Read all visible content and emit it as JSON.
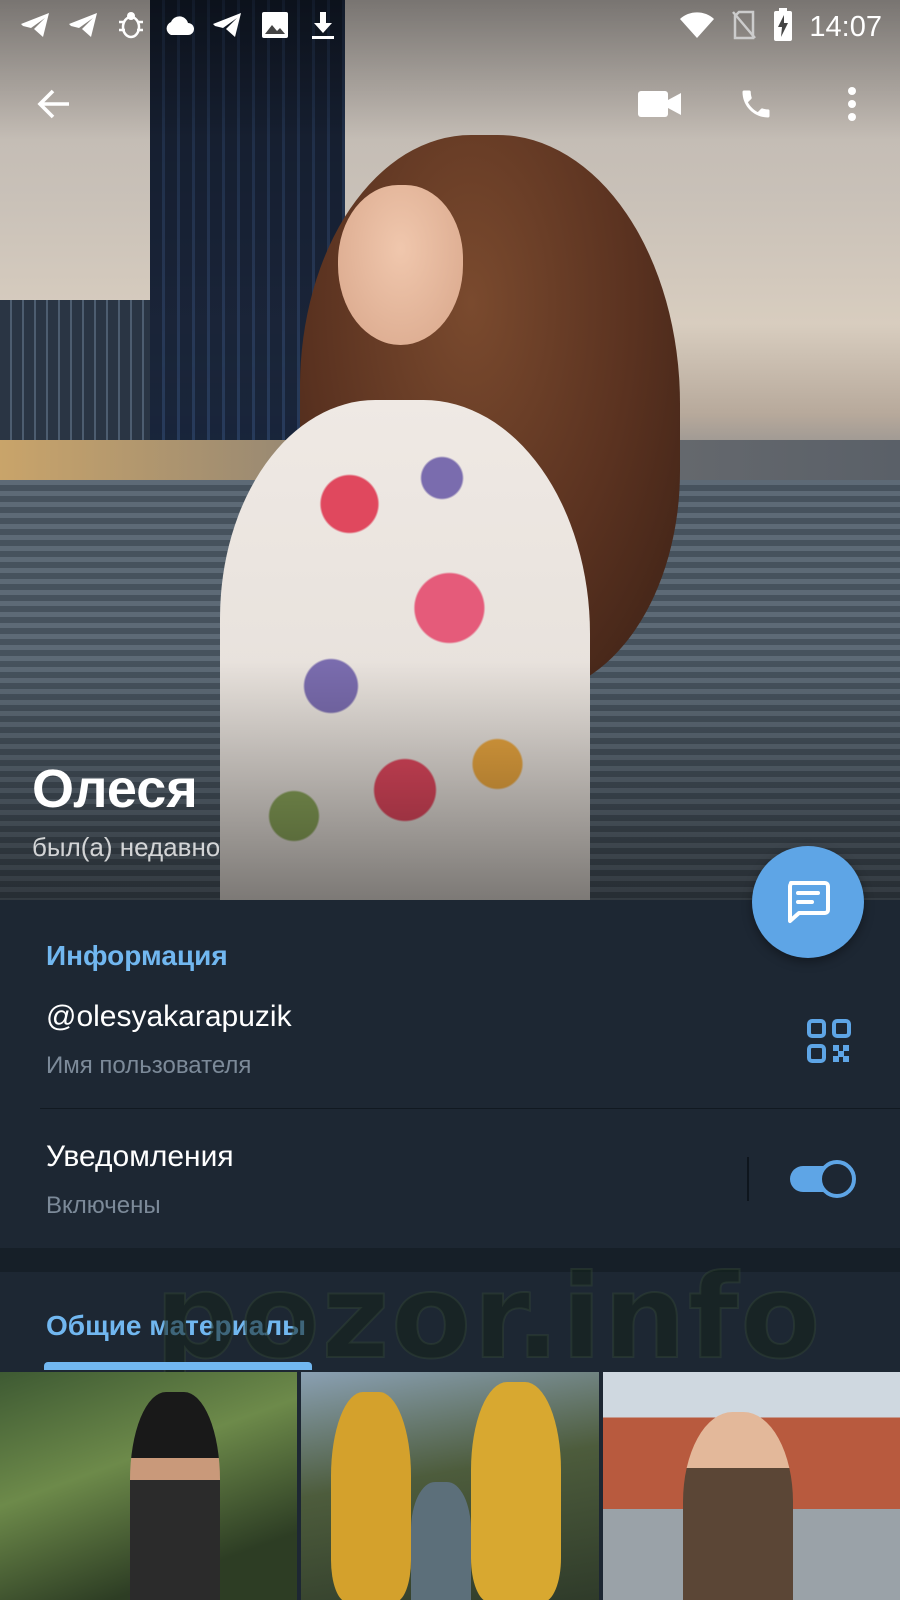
{
  "status_bar": {
    "time": "14:07",
    "left_icons": [
      "telegram-icon",
      "telegram-icon",
      "bug-icon",
      "cloud-icon",
      "telegram-icon",
      "image-icon",
      "download-icon"
    ],
    "right_icons": [
      "wifi-icon",
      "no-sim-icon",
      "battery-charging-icon"
    ]
  },
  "action_bar": {
    "back_icon": "arrow-left-icon",
    "video_icon": "video-call-icon",
    "call_icon": "phone-icon",
    "menu_icon": "more-vertical-icon"
  },
  "profile": {
    "name": "Олеся",
    "status": "был(а) недавно"
  },
  "fab": {
    "icon": "message-icon",
    "color": "#5ea5e6"
  },
  "info": {
    "section_title": "Информация",
    "username": "@olesyakarapuzik",
    "username_caption": "Имя пользователя",
    "notifications_label": "Уведомления",
    "notifications_value": "Включены",
    "notifications_enabled": true
  },
  "media": {
    "tab_label": "Общие материалы",
    "watermark": "pozor.info",
    "thumbnails": [
      "photo-1",
      "photo-2",
      "photo-3"
    ]
  },
  "colors": {
    "accent": "#71b7f0",
    "background": "#1d2733",
    "toggle_on": "#5ea5e6"
  }
}
